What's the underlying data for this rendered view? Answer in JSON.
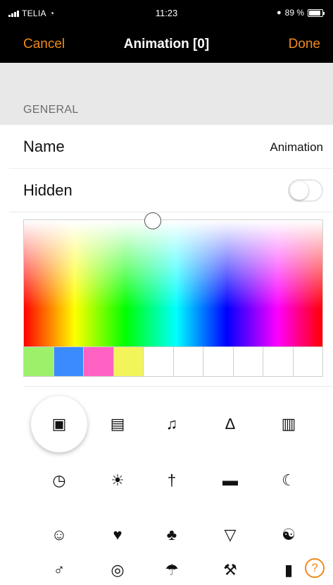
{
  "status_bar": {
    "carrier": "TELIA",
    "time": "11:23",
    "battery_text": "89 %",
    "battery_level": 0.89
  },
  "nav": {
    "cancel_label": "Cancel",
    "title": "Animation [0]",
    "done_label": "Done"
  },
  "section": {
    "title": "GENERAL"
  },
  "rows": {
    "name": {
      "label": "Name",
      "value": "Animation"
    },
    "hidden": {
      "label": "Hidden",
      "on": false
    }
  },
  "swatches": [
    "#9df06a",
    "#3b8bff",
    "#ff62c3",
    "#f2f45a",
    "#ffffff",
    "#ffffff",
    "#ffffff",
    "#ffffff",
    "#ffffff",
    "#ffffff"
  ],
  "icons": [
    [
      "film-icon",
      "presentation-icon",
      "music-note-icon",
      "lamp-icon",
      "book-icon"
    ],
    [
      "clock-icon",
      "sun-icon",
      "fork-knife-icon",
      "printer-icon",
      "moon-icon"
    ],
    [
      "mask-icon",
      "heart-icon",
      "cards-icon",
      "wine-glass-icon",
      "yin-yang-icon"
    ],
    [
      "chef-icon",
      "lightbulb-icon",
      "umbrella-lamp-icon",
      "hammer-icon",
      "dumbbell-icon"
    ]
  ],
  "selected_icon": "film-icon",
  "accent_color": "#f08a1c"
}
